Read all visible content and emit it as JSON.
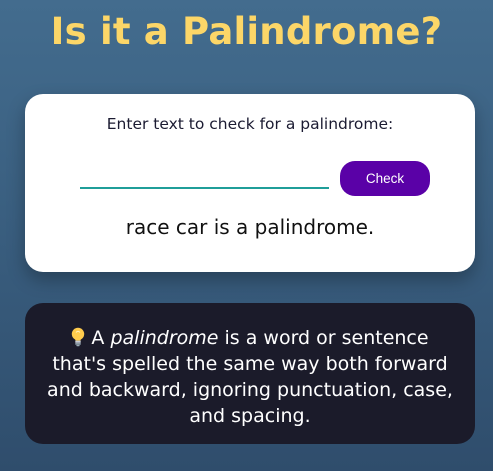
{
  "page": {
    "title": "Is it a Palindrome?"
  },
  "checker": {
    "label": "Enter text to check for a palindrome:",
    "input_value": "",
    "input_placeholder": "",
    "button_label": "Check",
    "result_text": "race car is a palindrome."
  },
  "info": {
    "icon": "lightbulb-icon",
    "prefix": "A ",
    "term": "palindrome",
    "definition": " is a word or sentence that's spelled the same way both forward and backward, ignoring punctuation, case, and spacing."
  },
  "colors": {
    "title": "#fcd668",
    "button": "#5a01a7",
    "input_underline": "#1f9e99",
    "info_background": "#1b1b2a"
  }
}
